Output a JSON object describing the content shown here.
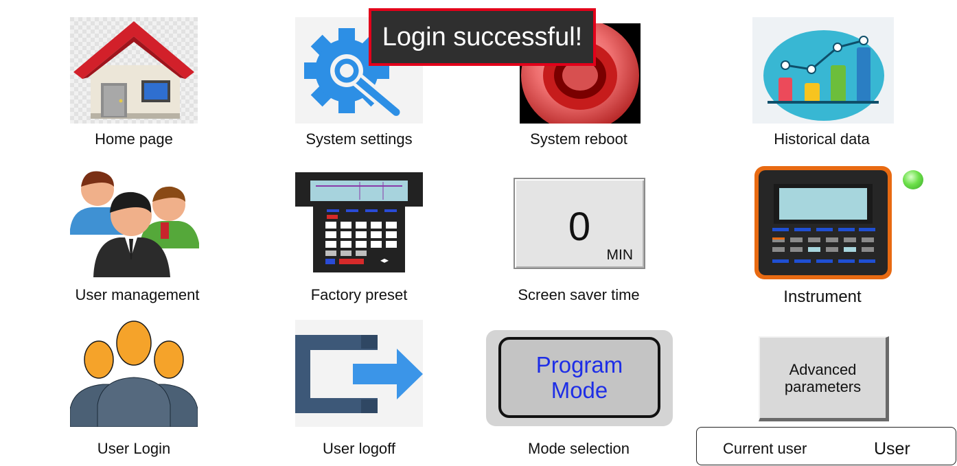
{
  "toast": {
    "message": "Login successful!"
  },
  "tiles": {
    "home": {
      "label": "Home page",
      "icon": "house-icon"
    },
    "settings": {
      "label": "System settings",
      "icon": "gear-wrench-icon"
    },
    "reboot": {
      "label": "System reboot",
      "icon": "red-power-button-icon"
    },
    "history": {
      "label": "Historical data",
      "icon": "bar-chart-icon"
    },
    "users": {
      "label": "User management",
      "icon": "users-group-icon"
    },
    "factory": {
      "label": "Factory preset",
      "icon": "keypad-device-icon"
    },
    "saver": {
      "label": "Screen saver time",
      "value": "0",
      "unit": "MIN"
    },
    "instrument": {
      "label": "Instrument",
      "icon": "orange-instrument-icon",
      "status_color": "#5fd93a"
    },
    "login": {
      "label": "User Login",
      "icon": "user-group-login-icon"
    },
    "logoff": {
      "label": "User logoff",
      "icon": "logout-arrow-icon"
    },
    "mode": {
      "label": "Mode selection",
      "line1": "Program",
      "line2": "Mode"
    },
    "advanced": {
      "line1": "Advanced",
      "line2": "parameters"
    }
  },
  "current_user": {
    "label": "Current user",
    "value": "User"
  },
  "colors": {
    "toast_border": "#e2001a",
    "mode_text": "#1e2ee6",
    "accent_blue": "#2d8fe5"
  }
}
